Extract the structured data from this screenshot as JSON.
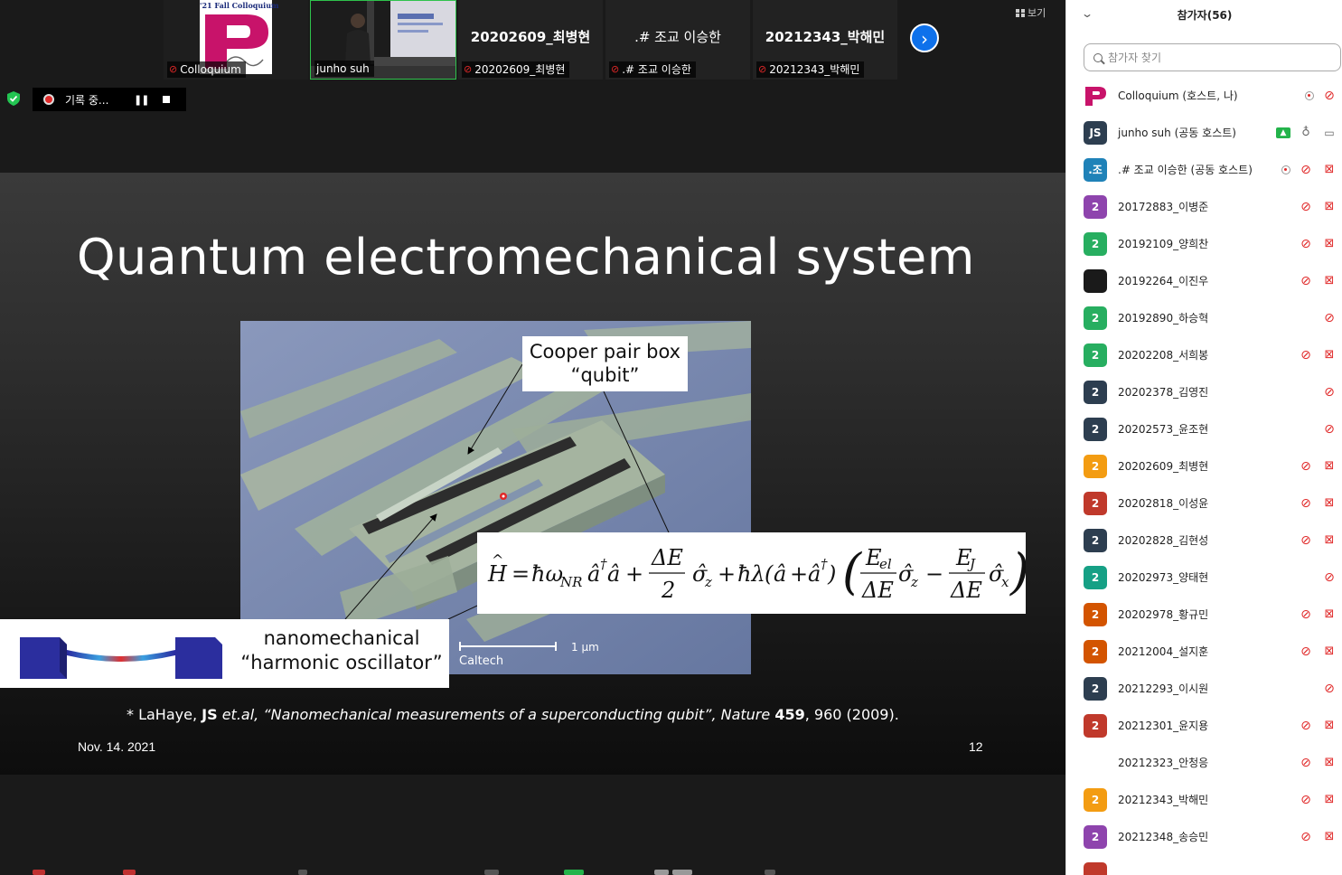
{
  "video_strip": {
    "tiles": [
      {
        "name": "Colloquium",
        "center_name": "",
        "mic_muted": true
      },
      {
        "name": "junho suh",
        "center_name": "",
        "mic_muted": false
      },
      {
        "name": "20202609_최병현",
        "center_name": "20202609_최병현",
        "mic_muted": true
      },
      {
        "name": ".# 조교 이승한",
        "center_name": ".# 조교 이승한",
        "mic_muted": true
      },
      {
        "name": "20212343_박해민",
        "center_name": "20212343_박해민",
        "mic_muted": true
      }
    ],
    "colloquium_logo_text": "'21 Fall Colloquium",
    "next_icon": "chevron-right-icon",
    "view_label": "보기"
  },
  "recording": {
    "label": "기록 중...",
    "icon": "record-dot-icon",
    "pause_glyph": "❚❚"
  },
  "slide": {
    "title": "Quantum electromechanical system",
    "cpb_label_line1": "Cooper pair box",
    "cpb_label_line2": "“qubit”",
    "osc_label_line1": "nanomechanical",
    "osc_label_line2": "“harmonic oscillator”",
    "scale_label": "1 μm",
    "photo_credit": "Caltech",
    "citation": {
      "prefix": "* LaHaye, ",
      "author": "JS",
      "etal": " et.al, ",
      "title": "“Nanomechanical measurements of a superconducting qubit”, Nature ",
      "volume": "459",
      "rest": ", 960 (2009)."
    },
    "date": "Nov. 14. 2021",
    "page_number": "12"
  },
  "panel": {
    "title": "참가자(56)",
    "search_placeholder": "참가자 찾기",
    "participants": [
      {
        "name": "Colloquium (호스트, 나)",
        "avatar": "logo",
        "avatar_color": "#ffffff",
        "icons": [
          "rec",
          "mic-off"
        ]
      },
      {
        "name": "junho suh (공동 호스트)",
        "avatar": "JS",
        "avatar_color": "#2d3e50",
        "icons": [
          "share",
          "mic-on",
          "cam-on"
        ]
      },
      {
        "name": ".# 조교 이승한 (공동 호스트)",
        "avatar": ".조",
        "avatar_color": "#1f82b8",
        "icons": [
          "rec",
          "mic-off",
          "cam-off"
        ]
      },
      {
        "name": "20172883_이병준",
        "avatar": "2",
        "avatar_color": "#8e44ad",
        "icons": [
          "mic-off",
          "cam-off"
        ]
      },
      {
        "name": "20192109_양희찬",
        "avatar": "2",
        "avatar_color": "#27ae60",
        "icons": [
          "mic-off",
          "cam-off"
        ]
      },
      {
        "name": "20192264_이진우",
        "avatar": "",
        "avatar_color": "#1a1a1a",
        "icons": [
          "mic-off",
          "cam-off"
        ]
      },
      {
        "name": "20192890_하승혁",
        "avatar": "2",
        "avatar_color": "#27ae60",
        "icons": [
          "mic-off"
        ]
      },
      {
        "name": "20202208_서희봉",
        "avatar": "2",
        "avatar_color": "#27ae60",
        "icons": [
          "mic-off",
          "cam-off"
        ]
      },
      {
        "name": "20202378_김영진",
        "avatar": "2",
        "avatar_color": "#2d3e50",
        "icons": [
          "mic-off"
        ]
      },
      {
        "name": "20202573_윤조현",
        "avatar": "2",
        "avatar_color": "#2d3e50",
        "icons": [
          "mic-off"
        ]
      },
      {
        "name": "20202609_최병현",
        "avatar": "2",
        "avatar_color": "#f39c12",
        "icons": [
          "mic-off",
          "cam-off"
        ]
      },
      {
        "name": "20202818_이성윤",
        "avatar": "2",
        "avatar_color": "#c0392b",
        "icons": [
          "mic-off",
          "cam-off"
        ]
      },
      {
        "name": "20202828_김현성",
        "avatar": "2",
        "avatar_color": "#2d3e50",
        "icons": [
          "mic-off",
          "cam-off"
        ]
      },
      {
        "name": "20202973_양태현",
        "avatar": "2",
        "avatar_color": "#16a085",
        "icons": [
          "mic-off"
        ]
      },
      {
        "name": "20202978_황규민",
        "avatar": "2",
        "avatar_color": "#d35400",
        "icons": [
          "mic-off",
          "cam-off"
        ]
      },
      {
        "name": "20212004_설지훈",
        "avatar": "2",
        "avatar_color": "#d35400",
        "icons": [
          "mic-off",
          "cam-off"
        ]
      },
      {
        "name": "20212293_이시원",
        "avatar": "2",
        "avatar_color": "#2d3e50",
        "icons": [
          "mic-off"
        ]
      },
      {
        "name": "20212301_윤지용",
        "avatar": "2",
        "avatar_color": "#c0392b",
        "icons": [
          "mic-off",
          "cam-off"
        ]
      },
      {
        "name": "20212323_안청응",
        "avatar": "",
        "avatar_color": "#ffffff",
        "icons": [
          "mic-off",
          "cam-off"
        ]
      },
      {
        "name": "20212343_박해민",
        "avatar": "2",
        "avatar_color": "#f39c12",
        "icons": [
          "mic-off",
          "cam-off"
        ]
      },
      {
        "name": "20212348_송승민",
        "avatar": "2",
        "avatar_color": "#8e44ad",
        "icons": [
          "mic-off",
          "cam-off"
        ]
      },
      {
        "name": "",
        "avatar": "",
        "avatar_color": "#c0392b",
        "icons": []
      }
    ]
  }
}
